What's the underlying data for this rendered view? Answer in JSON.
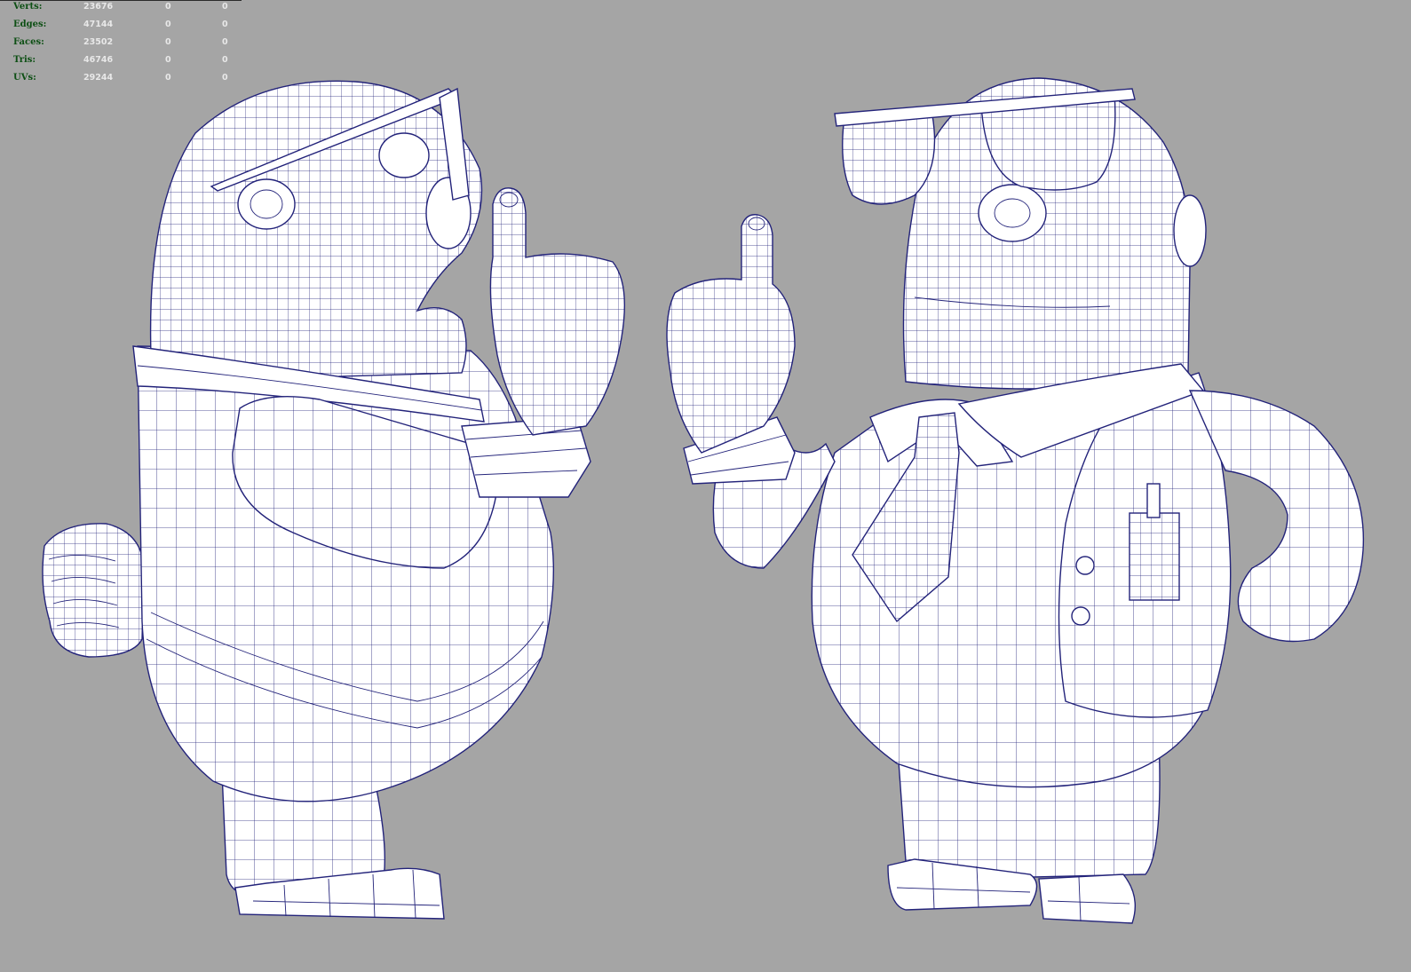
{
  "viewport": {
    "background": "#a5a5a5",
    "wire_color": "#23237a",
    "shading": "wireframe-on-shaded"
  },
  "hud": {
    "rows": [
      {
        "label": "Verts:",
        "values": [
          "23676",
          "0",
          "0"
        ]
      },
      {
        "label": "Edges:",
        "values": [
          "47144",
          "0",
          "0"
        ]
      },
      {
        "label": "Faces:",
        "values": [
          "23502",
          "0",
          "0"
        ]
      },
      {
        "label": "Tris:",
        "values": [
          "46746",
          "0",
          "0"
        ]
      },
      {
        "label": "UVs:",
        "values": [
          "29244",
          "0",
          "0"
        ]
      }
    ]
  }
}
